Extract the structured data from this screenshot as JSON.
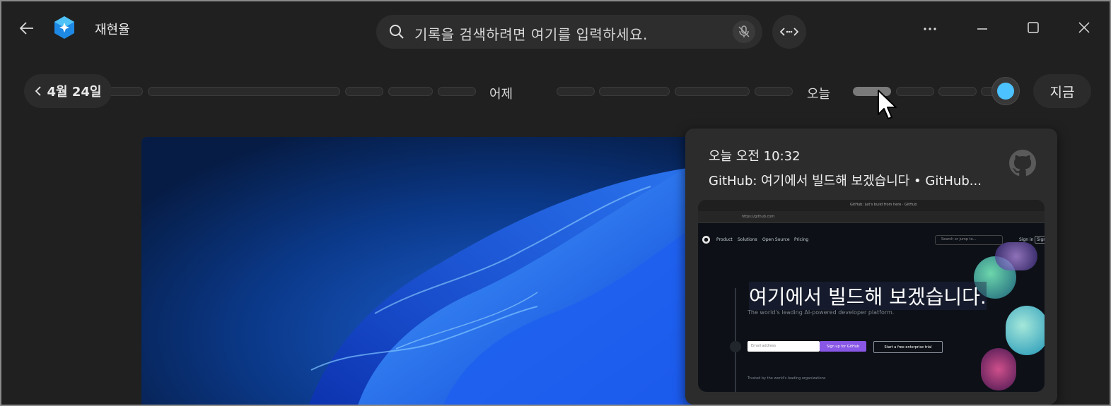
{
  "app": {
    "title": "재현율"
  },
  "search": {
    "placeholder": "기록을 검색하려면 여기를 입력하세요."
  },
  "timeline": {
    "date_button": "4월 24일",
    "yesterday_label": "어제",
    "today_label": "오늘",
    "now_button": "지금"
  },
  "card": {
    "time": "오늘 오전 10:32",
    "title": "GitHub: 여기에서 빌드해 보겠습니다 • GitHub...",
    "preview": {
      "tab_title": "GitHub: Let's build from here · GitHub",
      "url": "https://github.com",
      "nav": [
        "Product",
        "Solutions",
        "Open Source",
        "Pricing"
      ],
      "search_placeholder": "Search or jump to...",
      "sign_in": "Sign in",
      "sign_up": "Sign",
      "headline": "여기에서 빌드해 보겠습니다.",
      "subheadline": "The world's leading AI-powered developer platform.",
      "email_placeholder": "Email address",
      "signup_button": "Sign up for GitHub",
      "trial_button": "Start a free enterprise trial",
      "trusted": "Trusted by the world's leading organizations"
    }
  },
  "colors": {
    "background": "#202020",
    "accent": "#4cc2ff"
  }
}
